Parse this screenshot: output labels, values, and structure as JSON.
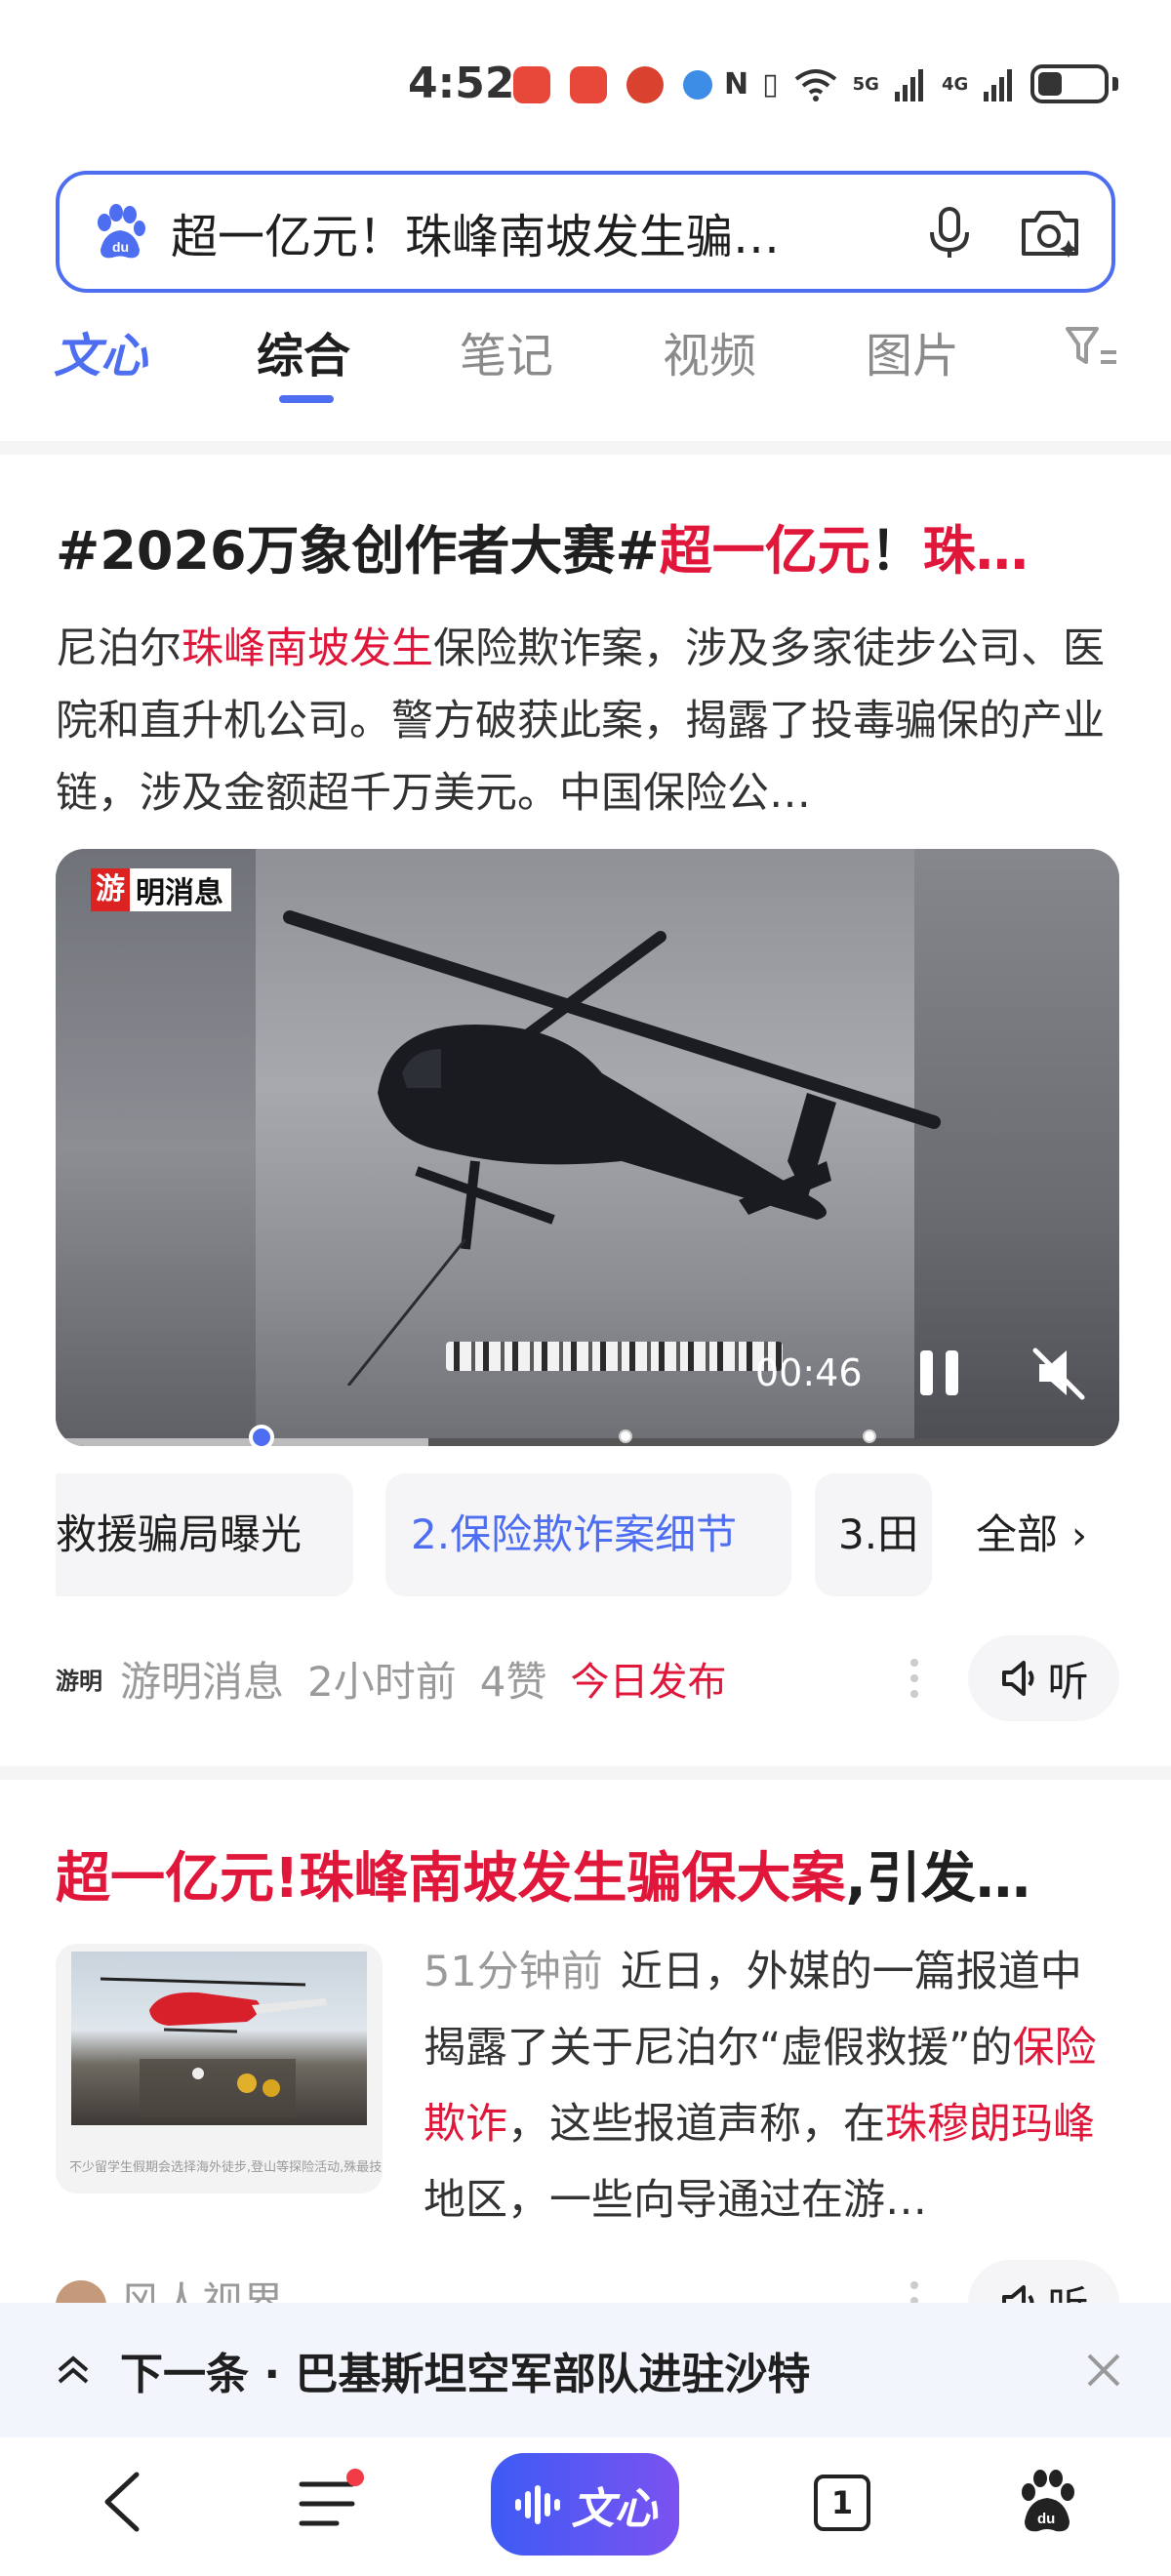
{
  "status_bar": {
    "time": "4:52",
    "network": "5G",
    "network2": "4G"
  },
  "search": {
    "query": "超一亿元！珠峰南坡发生骗…"
  },
  "tabs": [
    {
      "label": "文心"
    },
    {
      "label": "综合"
    },
    {
      "label": "笔记"
    },
    {
      "label": "视频"
    },
    {
      "label": "图片"
    }
  ],
  "result1": {
    "title_prefix": "#2026万象创作者大赛#",
    "title_red": "超一亿元",
    "title_mid": "！",
    "title_red2": "珠…",
    "desc_pre": "尼泊尔",
    "desc_red": "珠峰南坡发生",
    "desc_post": "保险欺诈案，涉及多家徒步公司、医院和直升机公司。警方破获此案，揭露了投毒骗保的产业链，涉及金额超千万美元。中国保险公…",
    "video": {
      "badge_char": "游",
      "badge_text": "明消息",
      "time": "00:46",
      "progress": 0.35
    },
    "chapters": [
      {
        "label": "救援骗局曝光"
      },
      {
        "label": "2.保险欺诈案细节"
      },
      {
        "label": "3.田"
      }
    ],
    "chapters_all": "全部",
    "source": {
      "logo": "游明",
      "name": "游明消息",
      "time": "2小时前",
      "likes": "4赞",
      "tag": "今日发布",
      "listen": "听"
    }
  },
  "result2": {
    "title_red": "超一亿元!珠峰南坡发生骗保大案",
    "title_rest": ",引发…",
    "ago": "51分钟前",
    "desc_1": "近日，外媒的一篇报道中揭露了关于尼泊尔“虚假救援”的",
    "desc_red1": "保险欺诈",
    "desc_2": "，这些报道声称，在",
    "desc_red2": "珠穆朗玛峰",
    "desc_3": "地区，一些向导通过在游…",
    "thumb_caption": "不少留学生假期会选择海外徒步,登山等探险活动,殊最技",
    "source_name": "风人视界"
  },
  "next_bar": {
    "text": "下一条 · 巴基斯坦空军部队进驻沙特"
  },
  "bottom_nav": {
    "wenxin": "文心",
    "tab_count": "1"
  },
  "colors": {
    "accent": "#4e6ef2",
    "highlight": "#e0173a"
  }
}
